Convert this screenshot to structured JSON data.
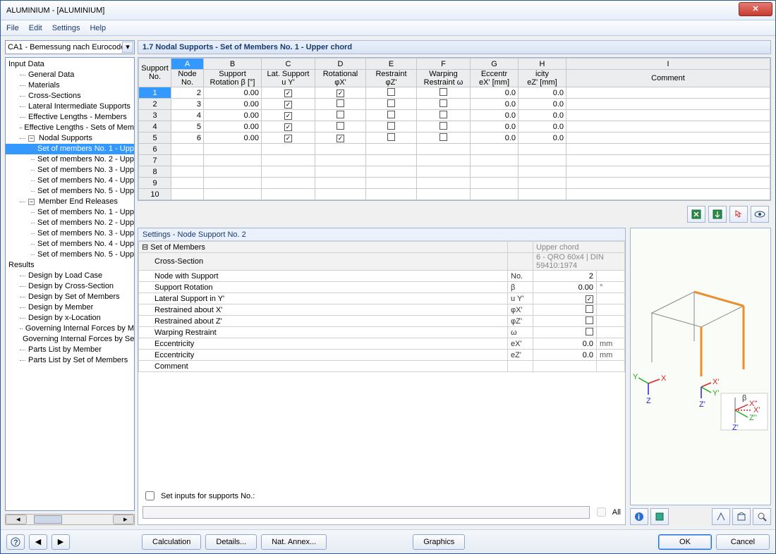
{
  "window": {
    "title": "ALUMINIUM - [ALUMINIUM]"
  },
  "menu": {
    "file": "File",
    "edit": "Edit",
    "settings": "Settings",
    "help": "Help"
  },
  "combo": {
    "value": "CA1 - Bemessung nach Eurocode"
  },
  "tree": {
    "input_data": "Input Data",
    "general_data": "General Data",
    "materials": "Materials",
    "cross_sections": "Cross-Sections",
    "lis": "Lateral Intermediate Supports",
    "eff_members": "Effective Lengths - Members",
    "eff_sets": "Effective Lengths - Sets of Mem",
    "nodal_supports": "Nodal Supports",
    "ns1": "Set of members No. 1 - Upp",
    "ns2": "Set of members No. 2 - Upp",
    "ns3": "Set of members No. 3 - Upp",
    "ns4": "Set of members No. 4 - Upp",
    "ns5": "Set of members No. 5 - Upp",
    "mer": "Member End Releases",
    "mer1": "Set of members No. 1 - Upp",
    "mer2": "Set of members No. 2 - Upp",
    "mer3": "Set of members No. 3 - Upp",
    "mer4": "Set of members No. 4 - Upp",
    "mer5": "Set of members No. 5 - Upp",
    "results": "Results",
    "r1": "Design by Load Case",
    "r2": "Design by Cross-Section",
    "r3": "Design by Set of Members",
    "r4": "Design by Member",
    "r5": "Design by x-Location",
    "r6": "Governing Internal Forces by M",
    "r7": "Governing Internal Forces by Se",
    "r8": "Parts List by Member",
    "r9": "Parts List by Set of Members"
  },
  "section": {
    "title": "1.7 Nodal Supports - Set of Members No. 1 - Upper chord"
  },
  "grid": {
    "head_letters": [
      "A",
      "B",
      "C",
      "D",
      "E",
      "F",
      "G",
      "H",
      "I"
    ],
    "head2": {
      "support_no": "Support\nNo.",
      "node_no": "Node\nNo.",
      "support_rot": "Support\nRotation β [°]",
      "lat": "Lat. Support\nu Y'",
      "rot_x": "φX'",
      "rot_z": "φZ'",
      "rotational": "Rotational Restraint",
      "warp": "Warping\nRestraint ω",
      "ecc": "Eccentricity",
      "ex": "eX' [mm]",
      "ez": "eZ' [mm]",
      "comment": "Comment"
    },
    "rows": [
      {
        "no": "1",
        "node": "2",
        "rot": "0.00",
        "lat": true,
        "rx": true,
        "rz": false,
        "w": false,
        "ex": "0.0",
        "ez": "0.0"
      },
      {
        "no": "2",
        "node": "3",
        "rot": "0.00",
        "lat": true,
        "rx": false,
        "rz": false,
        "w": false,
        "ex": "0.0",
        "ez": "0.0"
      },
      {
        "no": "3",
        "node": "4",
        "rot": "0.00",
        "lat": true,
        "rx": false,
        "rz": false,
        "w": false,
        "ex": "0.0",
        "ez": "0.0"
      },
      {
        "no": "4",
        "node": "5",
        "rot": "0.00",
        "lat": true,
        "rx": false,
        "rz": false,
        "w": false,
        "ex": "0.0",
        "ez": "0.0"
      },
      {
        "no": "5",
        "node": "6",
        "rot": "0.00",
        "lat": true,
        "rx": true,
        "rz": false,
        "w": false,
        "ex": "0.0",
        "ez": "0.0"
      }
    ],
    "empty_rows": [
      "6",
      "7",
      "8",
      "9",
      "10"
    ]
  },
  "settings_panel": {
    "title": "Settings - Node Support No. 2",
    "set_of_members_label": "Set of Members",
    "set_of_members_value": "Upper chord",
    "cross_section_label": "Cross-Section",
    "cross_section_value": "6 - QRO 60x4 | DIN 59410:1974",
    "rows": [
      {
        "label": "Node with Support",
        "sym": "No.",
        "val": "2",
        "unit": ""
      },
      {
        "label": "Support Rotation",
        "sym": "β",
        "val": "0.00",
        "unit": "°"
      },
      {
        "label": "Lateral Support in Y'",
        "sym": "u Y'",
        "chk": true
      },
      {
        "label": "Restrained about X'",
        "sym": "φX'",
        "chk": false
      },
      {
        "label": "Restrained about Z'",
        "sym": "φZ'",
        "chk": false
      },
      {
        "label": "Warping Restraint",
        "sym": "ω",
        "chk": false
      },
      {
        "label": "Eccentricity",
        "sym": "eX'",
        "val": "0.0",
        "unit": "mm"
      },
      {
        "label": "Eccentricity",
        "sym": "eZ'",
        "val": "0.0",
        "unit": "mm"
      },
      {
        "label": "Comment",
        "sym": "",
        "val": "",
        "unit": ""
      }
    ],
    "set_inputs_label": "Set inputs for supports No.:",
    "all_label": "All"
  },
  "footer": {
    "calculation": "Calculation",
    "details": "Details...",
    "nat_annex": "Nat. Annex...",
    "graphics": "Graphics",
    "ok": "OK",
    "cancel": "Cancel"
  }
}
